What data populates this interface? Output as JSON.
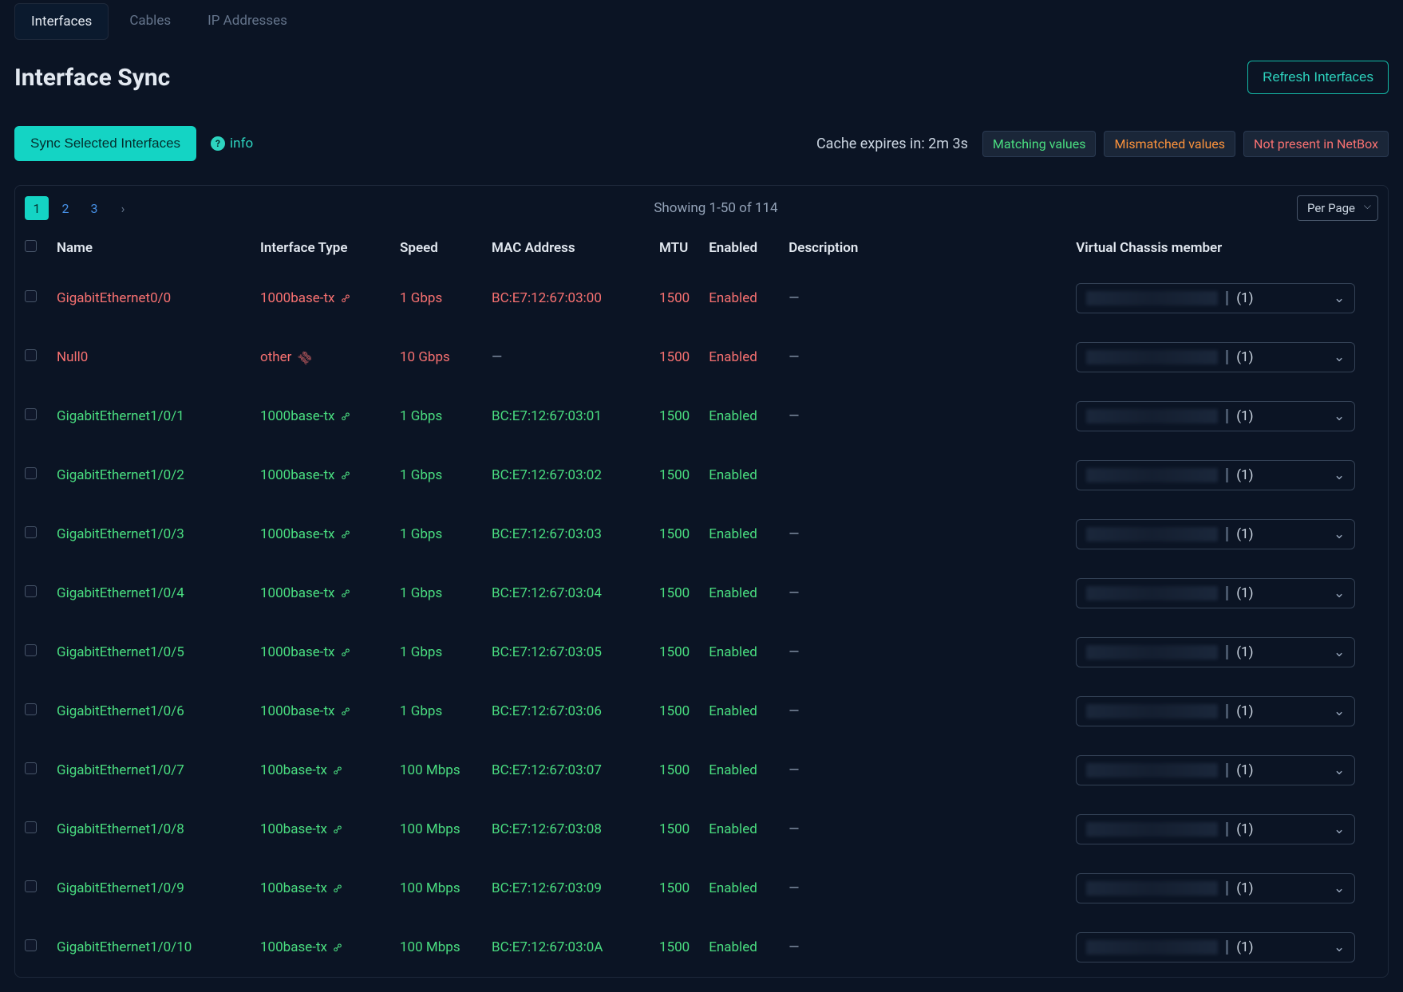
{
  "tabs": [
    {
      "label": "Interfaces",
      "active": true
    },
    {
      "label": "Cables",
      "active": false
    },
    {
      "label": "IP Addresses",
      "active": false
    }
  ],
  "title": "Interface Sync",
  "refresh_btn": "Refresh Interfaces",
  "sync_btn": "Sync Selected Interfaces",
  "info_label": "info",
  "cache_text": "Cache expires in: 2m 3s",
  "legend": {
    "match": "Matching values",
    "mismatch": "Mismatched values",
    "notpresent": "Not present in NetBox"
  },
  "pagination": {
    "pages": [
      "1",
      "2",
      "3"
    ],
    "active": 0,
    "showing": "Showing 1-50 of 114",
    "perpage": "Per Page"
  },
  "columns": {
    "name": "Name",
    "type": "Interface Type",
    "speed": "Speed",
    "mac": "MAC Address",
    "mtu": "MTU",
    "enabled": "Enabled",
    "desc": "Description",
    "vc": "Virtual Chassis member"
  },
  "rows": [
    {
      "status": "red",
      "name": "GigabitEthernet0/0",
      "type": "1000base-tx",
      "link": true,
      "speed": "1 Gbps",
      "mac": "BC:E7:12:67:03:00",
      "mtu": "1500",
      "enabled": "Enabled",
      "desc": "—",
      "vc": "(1)"
    },
    {
      "status": "red",
      "name": "Null0",
      "type": "other",
      "link": false,
      "speed": "10 Gbps",
      "mac": "—",
      "mtu": "1500",
      "enabled": "Enabled",
      "desc": "—",
      "vc": "(1)"
    },
    {
      "status": "green",
      "name": "GigabitEthernet1/0/1",
      "type": "1000base-tx",
      "link": true,
      "speed": "1 Gbps",
      "mac": "BC:E7:12:67:03:01",
      "mtu": "1500",
      "enabled": "Enabled",
      "desc": "—",
      "vc": "(1)"
    },
    {
      "status": "green",
      "name": "GigabitEthernet1/0/2",
      "type": "1000base-tx",
      "link": true,
      "speed": "1 Gbps",
      "mac": "BC:E7:12:67:03:02",
      "mtu": "1500",
      "enabled": "Enabled",
      "desc": "",
      "vc": "(1)"
    },
    {
      "status": "green",
      "name": "GigabitEthernet1/0/3",
      "type": "1000base-tx",
      "link": true,
      "speed": "1 Gbps",
      "mac": "BC:E7:12:67:03:03",
      "mtu": "1500",
      "enabled": "Enabled",
      "desc": "—",
      "vc": "(1)"
    },
    {
      "status": "green",
      "name": "GigabitEthernet1/0/4",
      "type": "1000base-tx",
      "link": true,
      "speed": "1 Gbps",
      "mac": "BC:E7:12:67:03:04",
      "mtu": "1500",
      "enabled": "Enabled",
      "desc": "—",
      "vc": "(1)"
    },
    {
      "status": "green",
      "name": "GigabitEthernet1/0/5",
      "type": "1000base-tx",
      "link": true,
      "speed": "1 Gbps",
      "mac": "BC:E7:12:67:03:05",
      "mtu": "1500",
      "enabled": "Enabled",
      "desc": "—",
      "vc": "(1)"
    },
    {
      "status": "green",
      "name": "GigabitEthernet1/0/6",
      "type": "1000base-tx",
      "link": true,
      "speed": "1 Gbps",
      "mac": "BC:E7:12:67:03:06",
      "mtu": "1500",
      "enabled": "Enabled",
      "desc": "—",
      "vc": "(1)"
    },
    {
      "status": "green",
      "name": "GigabitEthernet1/0/7",
      "type": "100base-tx",
      "link": true,
      "speed": "100 Mbps",
      "mac": "BC:E7:12:67:03:07",
      "mtu": "1500",
      "enabled": "Enabled",
      "desc": "—",
      "vc": "(1)"
    },
    {
      "status": "green",
      "name": "GigabitEthernet1/0/8",
      "type": "100base-tx",
      "link": true,
      "speed": "100 Mbps",
      "mac": "BC:E7:12:67:03:08",
      "mtu": "1500",
      "enabled": "Enabled",
      "desc": "—",
      "vc": "(1)"
    },
    {
      "status": "green",
      "name": "GigabitEthernet1/0/9",
      "type": "100base-tx",
      "link": true,
      "speed": "100 Mbps",
      "mac": "BC:E7:12:67:03:09",
      "mtu": "1500",
      "enabled": "Enabled",
      "desc": "—",
      "vc": "(1)"
    },
    {
      "status": "green",
      "name": "GigabitEthernet1/0/10",
      "type": "100base-tx",
      "link": true,
      "speed": "100 Mbps",
      "mac": "BC:E7:12:67:03:0A",
      "mtu": "1500",
      "enabled": "Enabled",
      "desc": "—",
      "vc": "(1)"
    }
  ]
}
